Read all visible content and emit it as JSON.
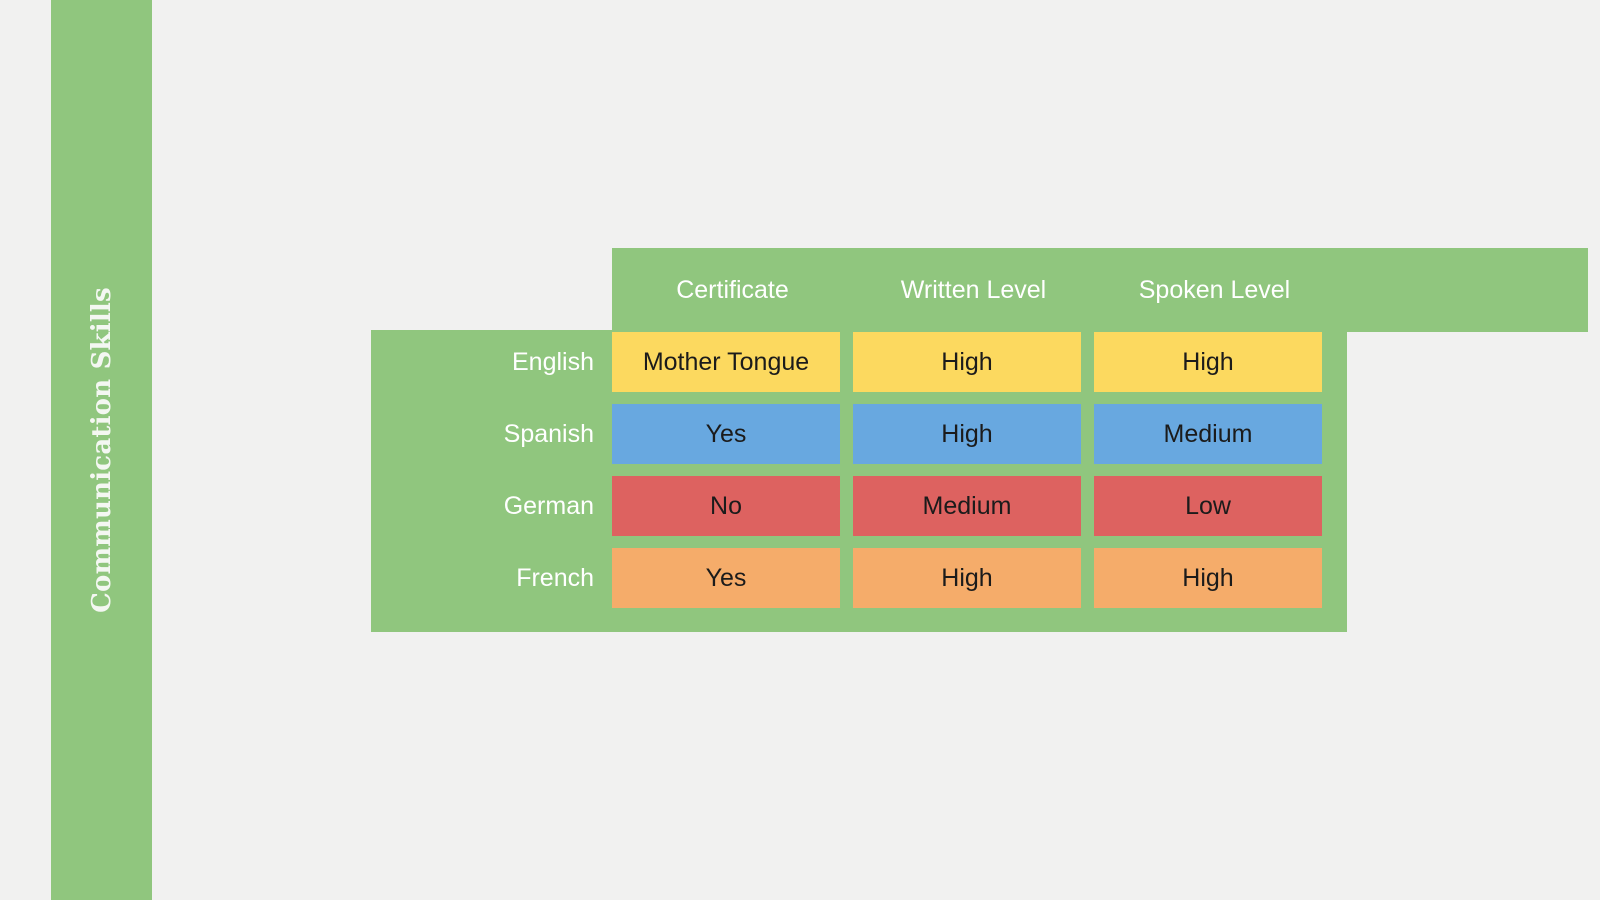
{
  "sidebar": {
    "title": "Communication Skills",
    "color": "#90c67e"
  },
  "table": {
    "corner_label": "",
    "columns": [
      "Certificate",
      "Written Level",
      "Spoken Level"
    ],
    "rows": [
      {
        "label": "English",
        "color": "#fcd95f",
        "cells": [
          "Mother Tongue",
          "High",
          "High"
        ]
      },
      {
        "label": "Spanish",
        "color": "#68a8e0",
        "cells": [
          "Yes",
          "High",
          "Medium"
        ]
      },
      {
        "label": "German",
        "color": "#dd6260",
        "cells": [
          "No",
          "Medium",
          "Low"
        ]
      },
      {
        "label": "French",
        "color": "#f5ac6a",
        "cells": [
          "Yes",
          "High",
          "High"
        ]
      }
    ]
  },
  "theme": {
    "background": "#f1f1f0",
    "panel_green": "#90c67e",
    "header_text": "#ffffff",
    "cell_text": "#1b1b1b"
  }
}
